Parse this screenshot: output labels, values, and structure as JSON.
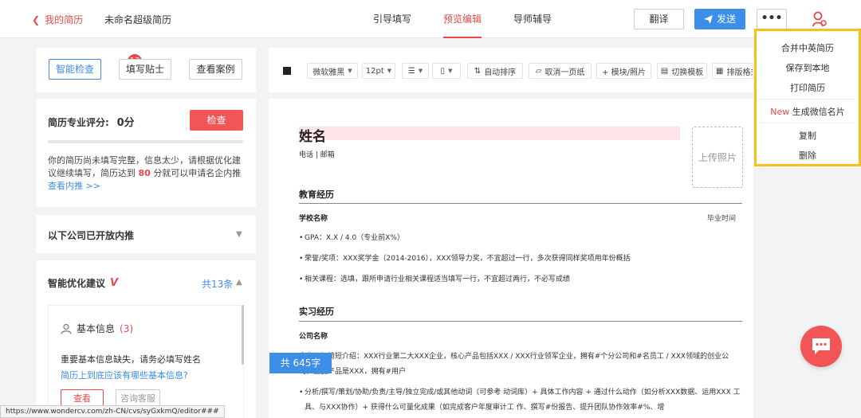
{
  "topbar": {
    "back_label": "我的简历",
    "doc_title": "未命名超级简历",
    "tabs": [
      {
        "label": "引导填写"
      },
      {
        "label": "预览编辑"
      },
      {
        "label": "导师辅导"
      }
    ],
    "translate_label": "翻译",
    "send_label": "发送",
    "more_label": "•••"
  },
  "left": {
    "smart_check_label": "智能检查",
    "smart_check_badge": "13",
    "tips_label": "填写贴士",
    "cases_label": "查看案例",
    "score": {
      "label": "简历专业评分:",
      "value": "0分",
      "check_label": "检查",
      "progress": 0,
      "tip_text_1": "你的简历尚未填写完整，信息太少，请根据优化建议继续填写，简历达到",
      "tip_highlight": "80",
      "tip_text_2": "分就可以申请名企内推",
      "tip_link": "查看内推 >>"
    },
    "companies_title": "以下公司已开放内推",
    "suggestions": {
      "title": "智能优化建议",
      "v_mark": "V",
      "count_label": "共13条",
      "basic_info_label": "基本信息",
      "basic_info_count": "(3)",
      "warning_text": "重要基本信息缺失，请务必填写姓名",
      "link_text": "简历上到底应该有哪些基本信息?",
      "view_label": "查看",
      "consult_label": "咨询客服"
    }
  },
  "toolbar": {
    "font": "微软雅黑",
    "size": "12pt",
    "auto_sort": "自动排序",
    "cancel_one_page": "取消一页纸",
    "module_photo": "+ 模块/照片",
    "switch_template": "切换模板",
    "layout": "排版格式"
  },
  "resume": {
    "name": "姓名",
    "contact": "电话 | 邮箱",
    "photo_label": "上传照片",
    "education_title": "教育经历",
    "school_name": "学校名称",
    "graduation_time": "毕业时间",
    "edu_bullets": [
      "GPA：X.X / 4.0（专业前X%）",
      "荣誉/奖项：XXX奖学金（2014-2016），XXX领导力奖，不宜超过一行，多次获得同样奖项用年份概括",
      "相关课程：选填，跟所申请行业相关课程适当填写一行，不宜超过两行，不必写成绩"
    ],
    "internship_title": "实习经历",
    "company_name": "公司名称",
    "company_intro": "企业可加简短介绍：XXX行业第二大XXX企业，核心产品包括XXX / XXX行业领军企业，拥有#个分公司和#名员工 / XXX领域的创业公司，主要产品是XXX，拥有#用户",
    "work_bullet": "分析/撰写/策划/协助/负责/主导/独立完成/或其他动词（可参考 动词库）+ 具体工作内容 + 通过什么动作（如分析XXX数据、运用XXX 工具、与XXX协作）+ 获得什么可量化成果（如完成客户年度审计工 作、撰写#份报告、提升团队协作效率#%、增"
  },
  "word_count_label": "共 645字",
  "menu": {
    "items": [
      {
        "label": "合并中英简历"
      },
      {
        "label": "保存到本地"
      },
      {
        "label": "打印简历"
      },
      {
        "new": "New",
        "label": "生成微信名片"
      },
      {
        "label": "复制"
      },
      {
        "label": "删除"
      }
    ]
  },
  "status_url": "https://www.wondercv.com/zh-CN/cvs/syGxkmQ/editor###",
  "colors": {
    "accent_red": "#e84a4a",
    "accent_blue": "#3d8ee8",
    "highlight_border": "#f5c116"
  }
}
